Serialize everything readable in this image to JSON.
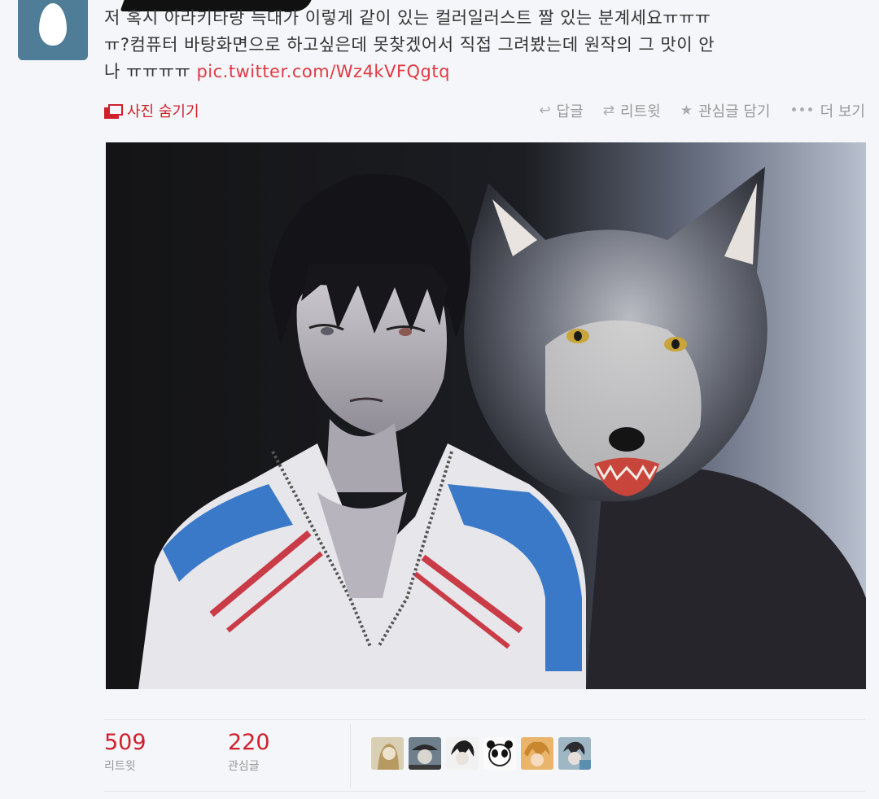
{
  "tweet": {
    "text_line1": "저 혹시 아라키타랑 늑대가 이렇게 같이 있는 컬러일러스트 짤 있는 분계세요ㅠㅠㅠ",
    "text_line2": "ㅠ?컴퓨터 바탕화면으로 하고싶은데 못찾겠어서 직접 그려봤는데 원작의 그 맛이 안",
    "text_line3_prefix": "나 ㅠㅠㅠㅠ ",
    "link": "pic.twitter.com/Wz4kVFQgtq"
  },
  "actions": {
    "hide_photo": "사진 숨기기",
    "reply": "답글",
    "retweet": "리트윗",
    "favorite": "관심글 담기",
    "more": "더 보기"
  },
  "stats": {
    "retweets": {
      "count": "509",
      "label": "리트윗"
    },
    "favorites": {
      "count": "220",
      "label": "관심글"
    }
  },
  "colors": {
    "accent": "#d0202c",
    "link": "#e03a42",
    "muted": "#999999",
    "avatar_bg": "#4f7c97"
  },
  "icons": {
    "hide_photo": "photo-stack-icon",
    "reply": "reply-arrow-icon",
    "retweet": "retweet-icon",
    "favorite": "star-icon",
    "more": "ellipsis-icon"
  }
}
